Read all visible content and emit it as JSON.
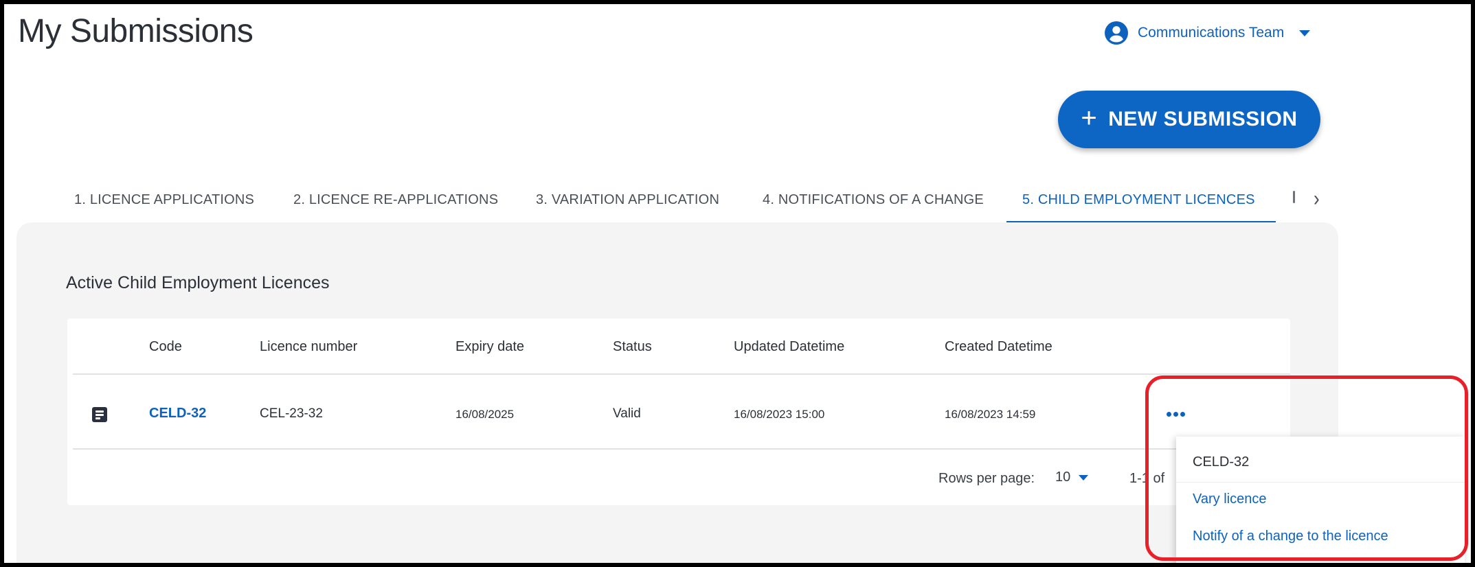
{
  "page": {
    "title": "My Submissions"
  },
  "account": {
    "name": "Communications Team",
    "icon": "account-circle-icon"
  },
  "actions": {
    "new_submission_label": "NEW SUBMISSION",
    "new_submission_icon": "+"
  },
  "tabs": [
    {
      "label": "1. LICENCE APPLICATIONS",
      "active": false
    },
    {
      "label": "2. LICENCE RE-APPLICATIONS",
      "active": false
    },
    {
      "label": "3. VARIATION APPLICATION",
      "active": false
    },
    {
      "label": "4. NOTIFICATIONS OF A CHANGE",
      "active": false
    },
    {
      "label": "5. CHILD EMPLOYMENT LICENCES",
      "active": true
    }
  ],
  "tab_scroll_icon": "›",
  "section": {
    "title": "Active Child Employment Licences"
  },
  "table": {
    "columns": [
      "Code",
      "Licence number",
      "Expiry date",
      "Status",
      "Updated Datetime",
      "Created Datetime"
    ],
    "rows": [
      {
        "code": "CELD-32",
        "licence_number": "CEL-23-32",
        "expiry_date": "16/08/2025",
        "status": "Valid",
        "updated": "16/08/2023 15:00",
        "created": "16/08/2023 14:59"
      }
    ]
  },
  "pagination": {
    "rows_per_page_label": "Rows per page:",
    "rows_per_page_value": "10",
    "range": "1-1 of"
  },
  "context_menu": {
    "header": "CELD-32",
    "items": [
      "Vary licence",
      "Notify of a change to the licence"
    ]
  },
  "colors": {
    "accent": "#0d62bd",
    "highlight": "#e8202a"
  }
}
